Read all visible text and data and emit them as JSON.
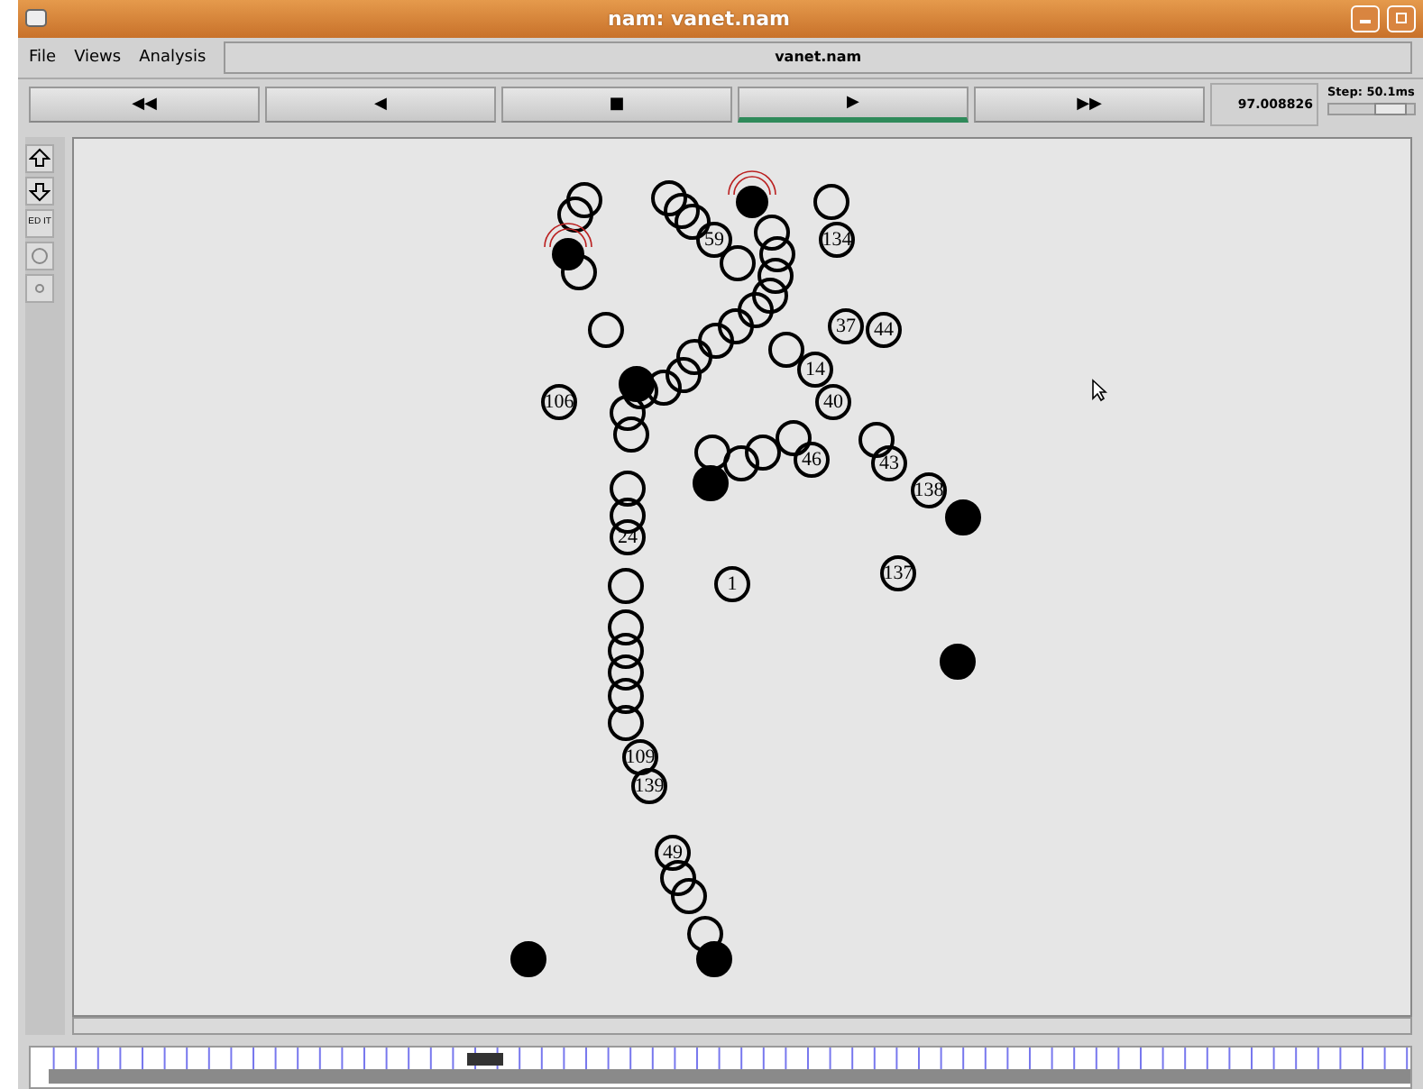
{
  "window": {
    "title": "nam: vanet.nam"
  },
  "menu": [
    {
      "label": "File"
    },
    {
      "label": "Views"
    },
    {
      "label": "Analysis"
    }
  ],
  "file_name": "vanet.nam",
  "transport": [
    {
      "glyph": "◀◀",
      "selected": false
    },
    {
      "glyph": "◀",
      "selected": false
    },
    {
      "glyph": "■",
      "selected": false
    },
    {
      "glyph": "▶",
      "selected": true
    },
    {
      "glyph": "▶▶",
      "selected": false
    }
  ],
  "time": "97.008826",
  "step": {
    "label": "Step: 50.1ms",
    "level": 0.85
  },
  "tools": [
    {
      "kind": "zoom-in"
    },
    {
      "kind": "zoom-out"
    },
    {
      "kind": "edit",
      "label": "ED IT"
    },
    {
      "kind": "circle"
    },
    {
      "kind": "dot"
    }
  ],
  "nodes": [
    {
      "kind": "ring",
      "label": "59"
    },
    {
      "kind": "ring",
      "label": "134"
    },
    {
      "kind": "ring",
      "label": "37"
    },
    {
      "kind": "ring",
      "label": "44"
    },
    {
      "kind": "ring",
      "label": "14"
    },
    {
      "kind": "ring",
      "label": "40"
    },
    {
      "kind": "ring",
      "label": "106"
    },
    {
      "kind": "ring",
      "label": "46"
    },
    {
      "kind": "ring",
      "label": "43"
    },
    {
      "kind": "ring",
      "label": "138"
    },
    {
      "kind": "ring",
      "label": "1"
    },
    {
      "kind": "ring",
      "label": "137"
    },
    {
      "kind": "ring",
      "label": "24"
    },
    {
      "kind": "ring",
      "label": "109"
    },
    {
      "kind": "ring",
      "label": "139"
    },
    {
      "kind": "ring",
      "label": "49"
    },
    {
      "kind": "cluster"
    },
    {
      "kind": "cluster"
    },
    {
      "kind": "cluster"
    },
    {
      "kind": "cluster"
    },
    {
      "kind": "cluster"
    },
    {
      "kind": "cluster"
    },
    {
      "kind": "cluster"
    },
    {
      "kind": "cluster"
    },
    {
      "kind": "cluster"
    },
    {
      "kind": "cluster"
    },
    {
      "kind": "cluster"
    },
    {
      "kind": "cluster"
    },
    {
      "kind": "cluster"
    },
    {
      "kind": "cluster"
    },
    {
      "kind": "cluster"
    },
    {
      "kind": "cluster"
    },
    {
      "kind": "cluster"
    },
    {
      "kind": "cluster"
    },
    {
      "kind": "cluster"
    },
    {
      "kind": "cluster"
    },
    {
      "kind": "cluster"
    },
    {
      "kind": "cluster"
    },
    {
      "kind": "cluster"
    },
    {
      "kind": "cluster"
    },
    {
      "kind": "cluster"
    },
    {
      "kind": "cluster"
    },
    {
      "kind": "cluster"
    },
    {
      "kind": "cluster"
    },
    {
      "kind": "cluster"
    },
    {
      "kind": "cluster"
    },
    {
      "kind": "cluster"
    },
    {
      "kind": "cluster"
    },
    {
      "kind": "cluster"
    },
    {
      "kind": "cluster"
    },
    {
      "kind": "cluster"
    },
    {
      "kind": "cluster"
    },
    {
      "kind": "cluster"
    },
    {
      "kind": "cluster"
    },
    {
      "kind": "cluster"
    },
    {
      "kind": "transmitting"
    },
    {
      "kind": "solid"
    },
    {
      "kind": "solid"
    },
    {
      "kind": "solid"
    },
    {
      "kind": "solid"
    },
    {
      "kind": "solid"
    },
    {
      "kind": "transmitting"
    },
    {
      "kind": "solid"
    }
  ]
}
